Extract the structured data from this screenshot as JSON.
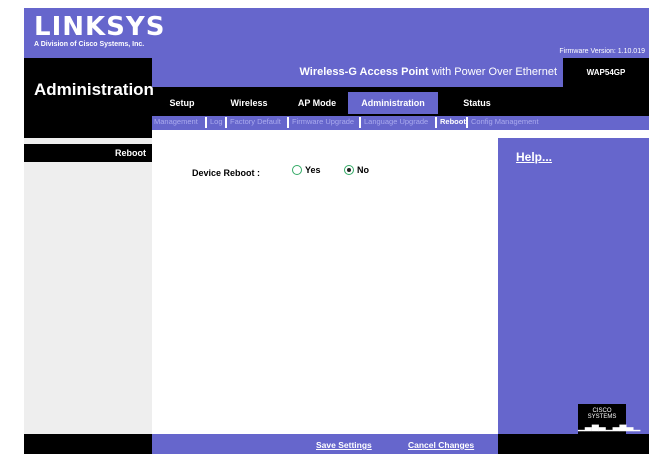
{
  "header": {
    "logo": "LINKSYS",
    "logo_sub": "A Division of Cisco Systems, Inc.",
    "firmware": "Firmware Version: 1.10.019"
  },
  "product": {
    "name_bold": "Wireless-G Access Point",
    "name_rest": " with Power Over Ethernet",
    "model": "WAP54GP"
  },
  "page_title": "Administration",
  "tabs": [
    "Setup",
    "Wireless",
    "AP Mode",
    "Administration",
    "Status"
  ],
  "active_tab": "Administration",
  "subnav": [
    "Management",
    "Log",
    "Factory Default",
    "Firmware Upgrade",
    "Language Upgrade",
    "Reboot",
    "Config Management"
  ],
  "active_subnav": "Reboot",
  "section": "Reboot",
  "form": {
    "label": "Device Reboot :",
    "options": [
      "Yes",
      "No"
    ],
    "selected": "No"
  },
  "help": "Help...",
  "cisco": "CISCO SYSTEMS",
  "buttons": {
    "save": "Save Settings",
    "cancel": "Cancel Changes"
  },
  "colors": {
    "brand_purple": "#6666cc",
    "black": "#000000",
    "panel_gray": "#eeeeee"
  }
}
